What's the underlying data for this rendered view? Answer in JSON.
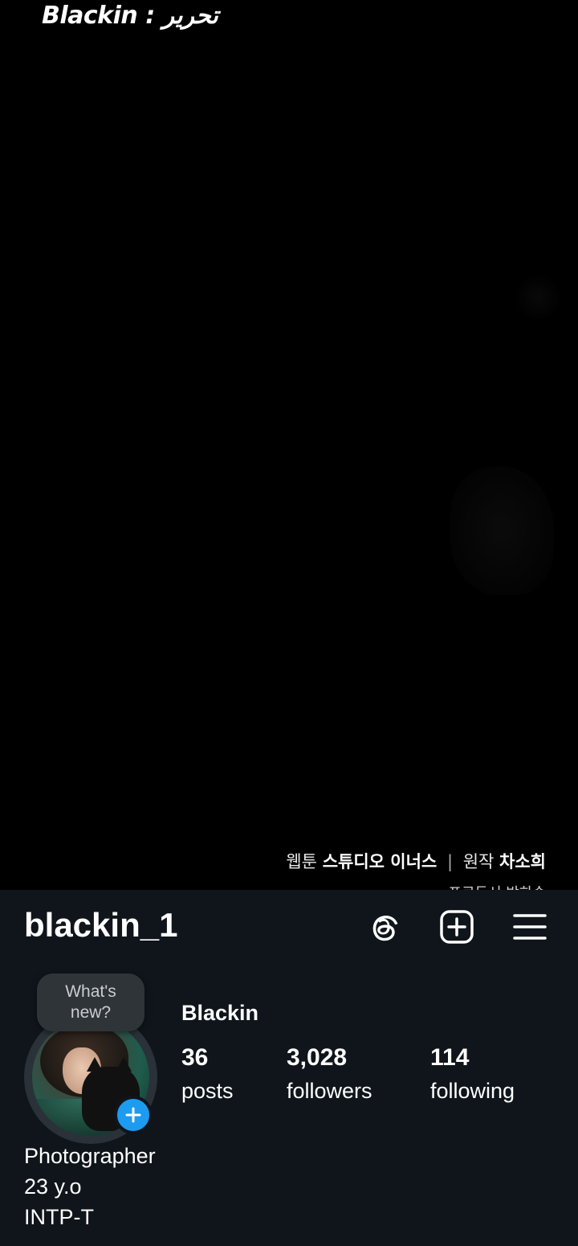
{
  "panel": {
    "watermark": "Blackin : تحرير",
    "credits": {
      "webtoon_label": "웹툰",
      "studio": "스튜디오 이너스",
      "separator": "|",
      "original_label": "원작",
      "author": "차소희",
      "producer_line": "프로듀서 박하송"
    }
  },
  "profile": {
    "username": "blackin_1",
    "icons": {
      "threads": "threads-icon",
      "create": "plus-square-icon",
      "menu": "hamburger-menu-icon"
    },
    "note_placeholder": "What's new?",
    "display_name": "Blackin",
    "stats": {
      "posts": {
        "count": "36",
        "label": "posts"
      },
      "followers": {
        "count": "3,028",
        "label": "followers"
      },
      "following": {
        "count": "114",
        "label": "following"
      }
    },
    "bio": [
      "Photographer",
      "23 y.o",
      "INTP-T"
    ],
    "colors": {
      "background": "#0f151b",
      "accent": "#1d9bf0",
      "text": "#ffffff",
      "note_bubble": "#2f3439"
    }
  }
}
